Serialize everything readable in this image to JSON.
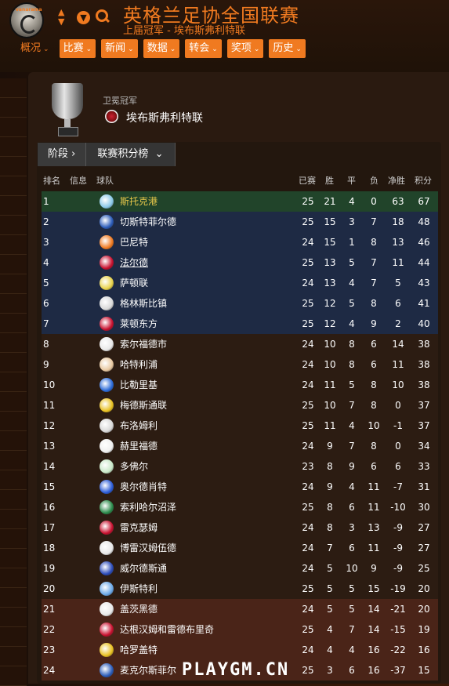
{
  "header": {
    "title": "英格兰足协全国联赛",
    "subtitle": "上届冠军 - 埃布斯弗利特联",
    "logo_text": "vanarama",
    "menu": [
      "概况",
      "比赛",
      "新闻",
      "数据",
      "转会",
      "奖项",
      "历史"
    ]
  },
  "champion": {
    "label": "卫冕冠军",
    "name": "埃布斯弗利特联"
  },
  "tabs": {
    "stage": "阶段",
    "table": "联赛积分榜"
  },
  "columns": {
    "rank": "排名",
    "info": "信息",
    "team": "球队",
    "played": "已赛",
    "won": "胜",
    "drawn": "平",
    "lost": "负",
    "gd": "净胜",
    "pts": "积分"
  },
  "teams": [
    {
      "rank": "1",
      "name": "斯托克港",
      "played": "25",
      "won": "21",
      "drawn": "4",
      "lost": "0",
      "gd": "63",
      "pts": "67",
      "badge": "#8ac8e8"
    },
    {
      "rank": "2",
      "name": "切斯特菲尔德",
      "played": "25",
      "won": "15",
      "drawn": "3",
      "lost": "7",
      "gd": "18",
      "pts": "48",
      "badge": "#2a5bb8"
    },
    {
      "rank": "3",
      "name": "巴尼特",
      "played": "24",
      "won": "15",
      "drawn": "1",
      "lost": "8",
      "gd": "13",
      "pts": "46",
      "badge": "#f07a20"
    },
    {
      "rank": "4",
      "name": "法尔德",
      "played": "25",
      "won": "13",
      "drawn": "5",
      "lost": "7",
      "gd": "11",
      "pts": "44",
      "badge": "#c8102e"
    },
    {
      "rank": "5",
      "name": "萨顿联",
      "played": "24",
      "won": "13",
      "drawn": "4",
      "lost": "7",
      "gd": "5",
      "pts": "43",
      "badge": "#e8d24a"
    },
    {
      "rank": "6",
      "name": "格林斯比镇",
      "played": "25",
      "won": "12",
      "drawn": "5",
      "lost": "8",
      "gd": "6",
      "pts": "41",
      "badge": "#d8d8d8"
    },
    {
      "rank": "7",
      "name": "莱顿东方",
      "played": "25",
      "won": "12",
      "drawn": "4",
      "lost": "9",
      "gd": "2",
      "pts": "40",
      "badge": "#c8102e"
    },
    {
      "rank": "8",
      "name": "索尔福德市",
      "played": "24",
      "won": "10",
      "drawn": "8",
      "lost": "6",
      "gd": "14",
      "pts": "38",
      "badge": "#e8e8e8"
    },
    {
      "rank": "9",
      "name": "哈特利浦",
      "played": "24",
      "won": "10",
      "drawn": "8",
      "lost": "6",
      "gd": "11",
      "pts": "38",
      "badge": "#e8c8a0"
    },
    {
      "rank": "10",
      "name": "比勒里基",
      "played": "24",
      "won": "11",
      "drawn": "5",
      "lost": "8",
      "gd": "10",
      "pts": "38",
      "badge": "#2a6ad8"
    },
    {
      "rank": "11",
      "name": "梅德斯通联",
      "played": "25",
      "won": "10",
      "drawn": "7",
      "lost": "8",
      "gd": "0",
      "pts": "37",
      "badge": "#e8c020"
    },
    {
      "rank": "12",
      "name": "布洛姆利",
      "played": "25",
      "won": "11",
      "drawn": "4",
      "lost": "10",
      "gd": "-1",
      "pts": "37",
      "badge": "#d8d8d8"
    },
    {
      "rank": "13",
      "name": "赫里福德",
      "played": "24",
      "won": "9",
      "drawn": "7",
      "lost": "8",
      "gd": "0",
      "pts": "34",
      "badge": "#f0f0f0"
    },
    {
      "rank": "14",
      "name": "多佛尔",
      "played": "23",
      "won": "8",
      "drawn": "9",
      "lost": "6",
      "gd": "6",
      "pts": "33",
      "badge": "#c8e8c8"
    },
    {
      "rank": "15",
      "name": "奥尔德肖特",
      "played": "24",
      "won": "9",
      "drawn": "4",
      "lost": "11",
      "gd": "-7",
      "pts": "31",
      "badge": "#2a5bd8"
    },
    {
      "rank": "16",
      "name": "索利哈尔沼泽",
      "played": "25",
      "won": "8",
      "drawn": "6",
      "lost": "11",
      "gd": "-10",
      "pts": "30",
      "badge": "#2a8a4a"
    },
    {
      "rank": "17",
      "name": "雷克瑟姆",
      "played": "24",
      "won": "8",
      "drawn": "3",
      "lost": "13",
      "gd": "-9",
      "pts": "27",
      "badge": "#c8102e"
    },
    {
      "rank": "18",
      "name": "博雷汉姆伍德",
      "played": "24",
      "won": "7",
      "drawn": "6",
      "lost": "11",
      "gd": "-9",
      "pts": "27",
      "badge": "#e8e8e8"
    },
    {
      "rank": "19",
      "name": "威尔德斯通",
      "played": "24",
      "won": "5",
      "drawn": "10",
      "lost": "9",
      "gd": "-9",
      "pts": "25",
      "badge": "#2a4ab8"
    },
    {
      "rank": "20",
      "name": "伊斯特利",
      "played": "25",
      "won": "5",
      "drawn": "5",
      "lost": "15",
      "gd": "-19",
      "pts": "20",
      "badge": "#6aa8e8"
    },
    {
      "rank": "21",
      "name": "盖茨黑德",
      "played": "24",
      "won": "5",
      "drawn": "5",
      "lost": "14",
      "gd": "-21",
      "pts": "20",
      "badge": "#e8e8e8"
    },
    {
      "rank": "22",
      "name": "达根汉姆和雷德布里奇",
      "played": "25",
      "won": "4",
      "drawn": "7",
      "lost": "14",
      "gd": "-15",
      "pts": "19",
      "badge": "#c8102e"
    },
    {
      "rank": "23",
      "name": "哈罗盖特",
      "played": "24",
      "won": "4",
      "drawn": "4",
      "lost": "16",
      "gd": "-22",
      "pts": "16",
      "badge": "#e8c020"
    },
    {
      "rank": "24",
      "name": "麦克尔斯菲尔",
      "played": "25",
      "won": "3",
      "drawn": "6",
      "lost": "16",
      "gd": "-37",
      "pts": "15",
      "badge": "#2a5bb8"
    }
  ],
  "watermark": "PLAYGM.CN",
  "colors": {
    "accent": "#f07a20",
    "champion_row": "#21442a",
    "playoff_row": "#1e2a44",
    "relegation_row": "#4a2418"
  }
}
